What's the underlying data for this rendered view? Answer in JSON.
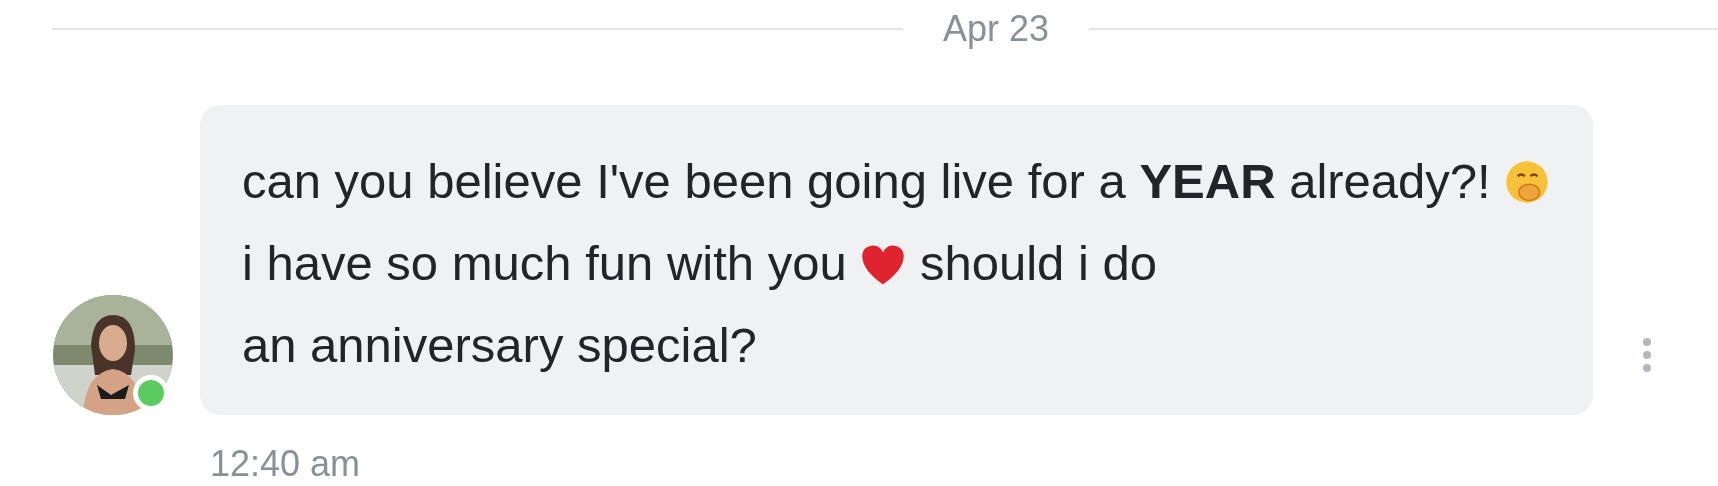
{
  "date_divider": {
    "label": "Apr 23"
  },
  "message": {
    "sender_online": true,
    "segments": [
      {
        "kind": "text",
        "text": "can you believe I've been going live for a **YEAR**"
      },
      {
        "kind": "text",
        "text": "already?!"
      },
      {
        "kind": "face"
      },
      {
        "kind": "text",
        "text": "i have so much fun with you"
      },
      {
        "kind": "heart"
      },
      {
        "kind": "text",
        "text": "should i do"
      },
      {
        "kind": "text",
        "text": "an anniversary special?"
      }
    ],
    "time": "12:40 am"
  }
}
